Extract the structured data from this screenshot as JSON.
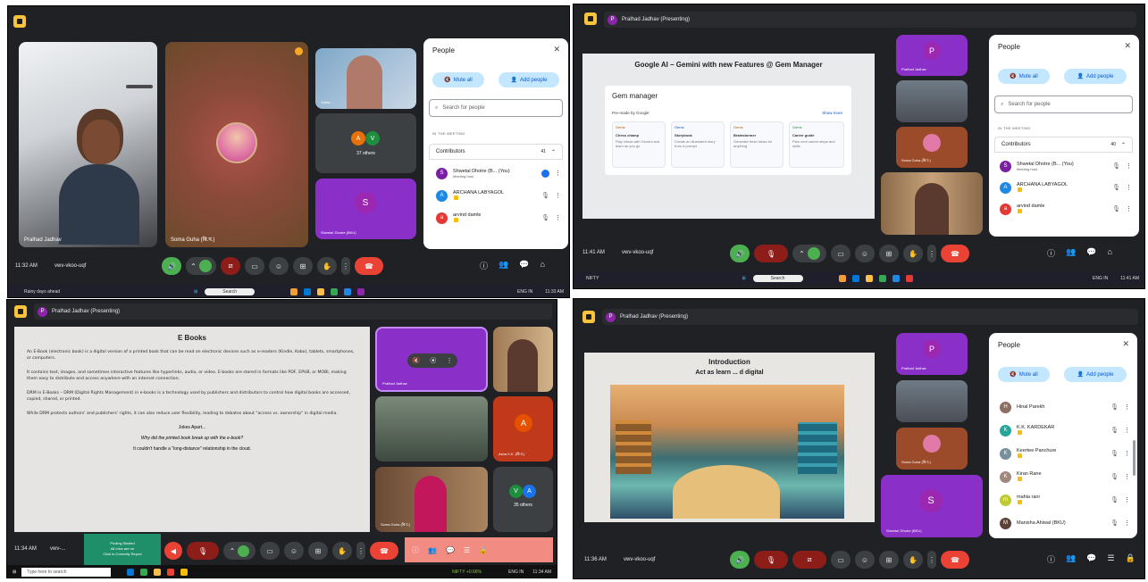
{
  "q1": {
    "time": "11:32 AM",
    "meeting_code": "vwv-vkoo-uqf",
    "tiles": [
      {
        "name": "Pralhad Jadhav"
      },
      {
        "name": "Soma Guha (बि.प.)"
      },
      {
        "name": "Sarita ..."
      },
      {
        "name": "37 others",
        "initials": [
          "A",
          "V"
        ]
      },
      {
        "name": "Shweta! Dhotre (BKU)",
        "initial": "S"
      }
    ],
    "people": {
      "title": "People",
      "mute_all": "Mute all",
      "add_people": "Add people",
      "search_placeholder": "Search for people",
      "section": "IN THE MEETING",
      "contributors": "Contributors",
      "count": "41",
      "rows": [
        {
          "name": "Shwetal Dhotre (B... (You)",
          "sub": "Meeting host",
          "initial": "S",
          "color": "#7b1fa2"
        },
        {
          "name": "ARCHANA LABYAGOL",
          "sub": "",
          "initial": "A",
          "color": "#1e88e5"
        },
        {
          "name": "arvind damle",
          "sub": "",
          "initial": "a",
          "color": "#e53935"
        }
      ]
    },
    "taskbar": {
      "left": "Rainy days ahead",
      "search": "Search",
      "lang": "ENG IN",
      "clock": "11:33 AM"
    }
  },
  "q2": {
    "presenting": "Pralhad Jadhav (Presenting)",
    "presenter_initial": "P",
    "slide_title": "Google AI – Gemini with new Features @ Gem Manager",
    "gem_title": "Gem manager",
    "gem_sub": "Pre-made by Google",
    "gem_show_more": "Show more",
    "cards": [
      {
        "tag": "Gems",
        "title": "Chess champ",
        "desc": "Play chess with Gemini and learn as you go"
      },
      {
        "tag": "Gems",
        "title": "Storybook",
        "desc": "Create an illustrated story from a prompt"
      },
      {
        "tag": "Gems",
        "title": "Brainstormer",
        "desc": "Generate fresh ideas for anything"
      },
      {
        "tag": "Gems",
        "title": "Career guide",
        "desc": "Plan next career steps and skills"
      }
    ],
    "tiles": [
      {
        "name": "Pralhad Jadhav",
        "initial": "P"
      },
      {
        "name": ""
      },
      {
        "name": "Soma Guha (बि.प.)"
      },
      {
        "name": ""
      }
    ],
    "time": "11:41 AM",
    "meeting_code": "vwv-vkoo-uqf",
    "people": {
      "title": "People",
      "mute_all": "Mute all",
      "add_people": "Add people",
      "search_placeholder": "Search for people",
      "section": "IN THE MEETING",
      "contributors": "Contributors",
      "count": "40",
      "rows": [
        {
          "name": "Shwetal Dhotre (B... (You)",
          "sub": "Meeting host",
          "initial": "S",
          "color": "#7b1fa2"
        },
        {
          "name": "ARCHANA LABYAGOL",
          "sub": "",
          "initial": "A",
          "color": "#1e88e5"
        },
        {
          "name": "arvind damle",
          "sub": "",
          "initial": "a",
          "color": "#e53935"
        }
      ]
    },
    "taskbar": {
      "left": "NIFTY",
      "search": "Search",
      "lang": "ENG IN",
      "clock": "11:41 AM"
    }
  },
  "q3": {
    "presenting": "Pralhad Jadhav (Presenting)",
    "slide_title": "E Books",
    "paragraphs": [
      "An E-Book (electronic book) is a digital version of a printed book that can be read on electronic devices such as e-readers (Kindle, Kobo), tablets, smartphones, or computers.",
      "It contains text, images, and sometimes interactive features like hyperlinks, audio, or video. E-books are stored in formats like PDF, EPUB, or MOBI, making them easy to distribute and access anywhere with an internet connection.",
      "DRM in E-Books – DRM (Digital Rights Management) in e-books is a technology used by publishers and distributors to control how digital books are accessed, copied, shared, or printed.",
      "While DRM protects authors' and publishers' rights, it can also reduce user flexibility, leading to debates about \"access vs. ownership\" in digital media."
    ],
    "joke_title": "Jokes Apart...",
    "joke_q": "Why did the printed book break up with the e-book?",
    "joke_a": "It couldn't handle a \"long-distance\" relationship in the cloud.",
    "tiles": [
      {
        "name": "Pralhad Jadhav"
      },
      {
        "name": ""
      },
      {
        "name": ""
      },
      {
        "name": "Asha K.K. (बि.प.)",
        "initial": "A"
      },
      {
        "name": "Soma Guha (बि.प.)"
      },
      {
        "name": "35 others",
        "initials": [
          "V",
          "A"
        ]
      }
    ],
    "time": "11:34 AM",
    "meeting_code": "vwv-...",
    "toast": [
      "Pooling Started",
      "All mics are on",
      "Click to Correctly Report"
    ],
    "taskbar": {
      "search": "Type here to search",
      "ticker": "NIFTY +0.66%",
      "lang": "ENG IN",
      "clock": "11:34 AM"
    }
  },
  "q4": {
    "presenting": "Pralhad Jadhav (Presenting)",
    "slide_title": "Introduction",
    "slide_sub": "Act as learn ... d digital",
    "tiles": [
      {
        "name": "Pralhad Jadhav",
        "initial": "P"
      },
      {
        "name": ""
      },
      {
        "name": "Soma Guha (बि.प.)"
      },
      {
        "name": "Shweta! Dhotre (BKU)",
        "initial": "S"
      }
    ],
    "time": "11:36 AM",
    "meeting_code": "vwv-vkoo-uqf",
    "people": {
      "title": "People",
      "mute_all": "Mute all",
      "add_people": "Add people",
      "rows": [
        {
          "name": "Hinal Parekh",
          "initial": "H",
          "color": "#8d6e63"
        },
        {
          "name": "K.K. KARDEKAR",
          "initial": "K",
          "color": "#26a69a"
        },
        {
          "name": "Keertee Panchure",
          "initial": "K",
          "color": "#78909c"
        },
        {
          "name": "Kiran Rane",
          "initial": "K",
          "color": "#a1887f"
        },
        {
          "name": "mahia rani",
          "initial": "m",
          "color": "#c0ca33"
        },
        {
          "name": "Manisha Ahiwal (BKU)",
          "initial": "M",
          "color": "#5d4037"
        }
      ]
    }
  }
}
